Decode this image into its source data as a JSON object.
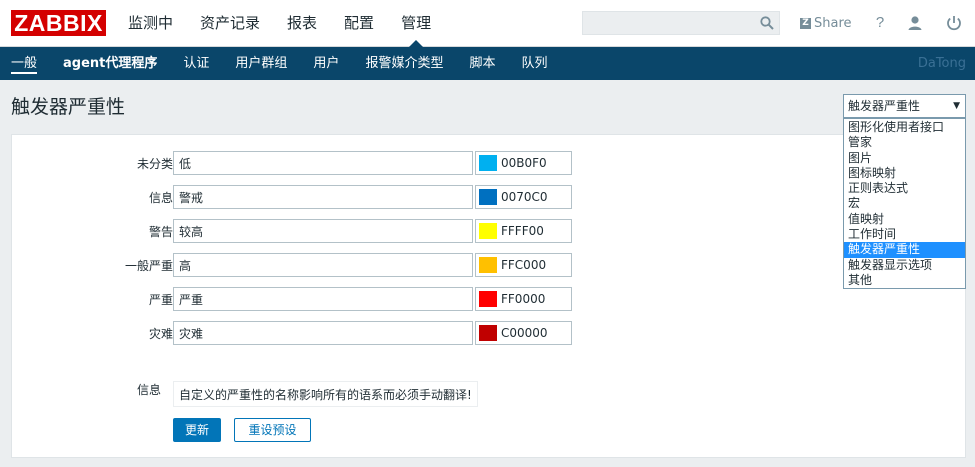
{
  "logo": "ZABBIX",
  "main_nav": [
    "监测中",
    "资产记录",
    "报表",
    "配置",
    "管理"
  ],
  "search": {
    "value": "",
    "placeholder": ""
  },
  "header_links": {
    "share": "Share",
    "share_badge": "Z",
    "help": "?"
  },
  "sub_nav": [
    "一般",
    "agent代理程序",
    "认证",
    "用户群组",
    "用户",
    "报警媒介类型",
    "脚本",
    "队列"
  ],
  "sub_nav_selected": "一般",
  "current_user": "DaTong",
  "page_title": "触发器严重性",
  "page_select": {
    "selected": "触发器严重性",
    "options": [
      "图形化使用者接口",
      "管家",
      "图片",
      "图标映射",
      "正则表达式",
      "宏",
      "值映射",
      "工作时间",
      "触发器严重性",
      "触发器显示选项",
      "其他"
    ]
  },
  "severities": [
    {
      "label": "未分类",
      "name": "低",
      "color": "00B0F0",
      "hex": "#00B0F0"
    },
    {
      "label": "信息",
      "name": "警戒",
      "color": "0070C0",
      "hex": "#0070C0"
    },
    {
      "label": "警告",
      "name": "较高",
      "color": "FFFF00",
      "hex": "#FFFF00"
    },
    {
      "label": "一般严重",
      "name": "高",
      "color": "FFC000",
      "hex": "#FFC000"
    },
    {
      "label": "严重",
      "name": "严重",
      "color": "FF0000",
      "hex": "#FF0000"
    },
    {
      "label": "灾难",
      "name": "灾难",
      "color": "C00000",
      "hex": "#C00000"
    }
  ],
  "info": {
    "label": "信息",
    "text": "自定义的严重性的名称影响所有的语系而必须手动翻译!"
  },
  "buttons": {
    "update": "更新",
    "reset": "重设预设"
  },
  "colors": {
    "brand": "#D40000",
    "nav": "#0A466A",
    "primary": "#0275B8"
  }
}
